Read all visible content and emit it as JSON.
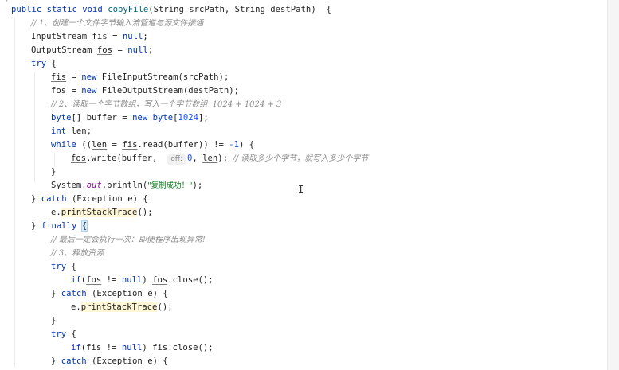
{
  "editor": {
    "top_fragment": "*/",
    "lines": {
      "l1_sig": [
        "public static void ",
        "copyFile",
        "(String srcPath, String destPath)  {"
      ],
      "l2_comment": "// 1、创建一个文件字节输入流管道与源文件接通",
      "l3_in_type": "InputStream ",
      "l3_in_var": "fis",
      "l3_in_rest": " = ",
      "l3_null": "null",
      "l3_semi": ";",
      "l4_out_type": "OutputStream ",
      "l4_out_var": "fos",
      "l4_out_rest": " = ",
      "l4_null": "null",
      "l4_semi": ";",
      "l5_try": "try",
      "l5_rest": " {",
      "l6_var": "fis",
      "l6_eq": " = ",
      "l6_new": "new",
      "l6_rest": " FileInputStream(srcPath);",
      "l7_var": "fos",
      "l7_eq": " = ",
      "l7_new": "new",
      "l7_rest": " FileOutputStream(destPath);",
      "l8_comment": "// 2、读取一个字节数组，写入一个字节数组  1024 + 1024 + 3",
      "l9_type": "byte",
      "l9_mid": "[] buffer = ",
      "l9_new": "new",
      "l9_type2": " byte",
      "l9_br1": "[",
      "l9_num": "1024",
      "l9_br2": "];",
      "l10_type": "int",
      "l10_rest": " len;",
      "l11_while": "while",
      "l11_a": " ((",
      "l11_len": "len",
      "l11_b": " = ",
      "l11_fis": "fis",
      "l11_c": ".read(buffer)) != ",
      "l11_num": "-1",
      "l11_d": ") {",
      "l12_fos": "fos",
      "l12_a": ".write(buffer,  ",
      "l12_hint": "off:",
      "l12_num": "0",
      "l12_b": ", ",
      "l12_len": "len",
      "l12_c": "); ",
      "l12_comment": "// 读取多少个字节，就写入多少个字节",
      "l13": "}",
      "l14_a": "System.",
      "l14_out": "out",
      "l14_b": ".println(",
      "l14_str": "\"复制成功！\"",
      "l14_c": ");",
      "l15_a": "} ",
      "l15_catch": "catch",
      "l15_b": " (Exception e) {",
      "l16_a": "e.",
      "l16_m": "printStackTrace",
      "l16_b": "();",
      "l17_a": "} ",
      "l17_finally": "finally",
      "l17_sp": " ",
      "l17_brace": "{",
      "l18_comment": "// 最后一定会执行一次：即便程序出现异常!",
      "l19_comment": "// 3、释放资源",
      "l20_try": "try",
      "l20_rest": " {",
      "l21_if": "if",
      "l21_a": "(",
      "l21_fos": "fos",
      "l21_b": " != ",
      "l21_null": "null",
      "l21_c": ") ",
      "l21_fos2": "fos",
      "l21_d": ".close();",
      "l22_a": "} ",
      "l22_catch": "catch",
      "l22_b": " (Exception e) {",
      "l23_a": "e.",
      "l23_m": "printStackTrace",
      "l23_b": "();",
      "l24": "}",
      "l25_try": "try",
      "l25_rest": " {",
      "l26_if": "if",
      "l26_a": "(",
      "l26_fis": "fis",
      "l26_b": " != ",
      "l26_null": "null",
      "l26_c": ") ",
      "l26_fis2": "fis",
      "l26_d": ".close();",
      "l27_a": "} ",
      "l27_catch": "catch",
      "l27_b": " (Exception e) {"
    }
  },
  "colors": {
    "keyword": "#0033b3",
    "comment": "#8c8c8c",
    "string": "#067d17",
    "number": "#1750eb",
    "field": "#871094",
    "highlight": "#fff6d6",
    "background": "#ffffff"
  },
  "icons": {
    "cursor": "text-cursor-icon"
  }
}
